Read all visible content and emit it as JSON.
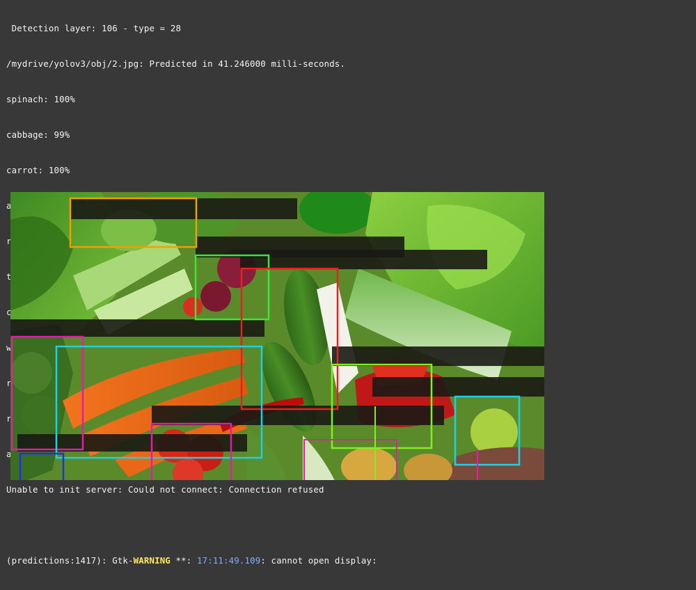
{
  "console": {
    "line_layer": " Detection layer: 106 - type = 28",
    "line_predicted": "/mydrive/yolov3/obj/2.jpg: Predicted in 41.246000 milli-seconds.",
    "detections": [
      "spinach: 100%",
      "cabbage: 99%",
      "carrot: 100%",
      "avacado: 94%",
      "red pepper: 100%",
      "tomato: 99%",
      "cucumber: 100%",
      "white potato: 90%",
      "red chilli: 100%",
      "red onion: 99%",
      "apple: 97%"
    ],
    "line_server": "Unable to init server: Could not connect: Connection refused",
    "warning": {
      "prefix": "(predictions:1417): Gtk-",
      "level": "WARNING",
      "stars": " **: ",
      "time": "17:11:49.109",
      "message": ": cannot open display:"
    }
  },
  "image": {
    "description_icon": "detection-result-image",
    "box_colors": {
      "orange": "#f0a000",
      "green": "#38e838",
      "red": "#e82020",
      "magenta": "#e020a0",
      "cyan": "#20d0e0",
      "lime": "#80f020",
      "blue": "#2030e0"
    }
  }
}
